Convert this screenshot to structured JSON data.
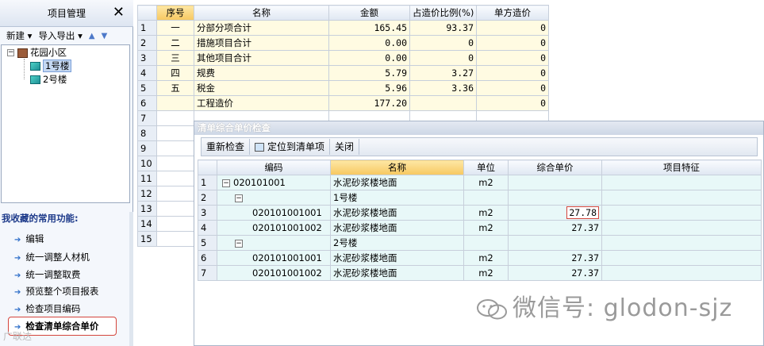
{
  "left_panel": {
    "title": "项目管理",
    "close": "✕",
    "toolbar": {
      "new": "新建 ▾",
      "import_export": "导入导出 ▾",
      "up": "▲",
      "down": "▼"
    },
    "tree": {
      "root": "花园小区",
      "nodes": [
        "1号楼",
        "2号楼"
      ]
    },
    "favorites_title": "我收藏的常用功能:",
    "favorites": [
      "编辑",
      "统一调整人材机",
      "统一调整取费",
      "预览整个项目报表",
      "检查项目编码",
      "检查清单综合单价"
    ]
  },
  "top_grid": {
    "headers": [
      "",
      "序号",
      "名称",
      "金额",
      "占造价比例(%)",
      "单方造价"
    ],
    "rows": [
      [
        "1",
        "一",
        "分部分项合计",
        "165.45",
        "93.37",
        "0"
      ],
      [
        "2",
        "二",
        "措施项目合计",
        "0.00",
        "0",
        "0"
      ],
      [
        "3",
        "三",
        "其他项目合计",
        "0.00",
        "0",
        "0"
      ],
      [
        "4",
        "四",
        "规费",
        "5.79",
        "3.27",
        "0"
      ],
      [
        "5",
        "五",
        "税金",
        "5.96",
        "3.36",
        "0"
      ],
      [
        "6",
        "",
        "工程造价",
        "177.20",
        "",
        "0"
      ],
      [
        "7",
        "",
        "",
        "",
        "",
        ""
      ],
      [
        "8",
        "",
        "",
        "",
        "",
        ""
      ],
      [
        "9",
        "",
        "",
        "",
        "",
        ""
      ],
      [
        "10",
        "",
        "",
        "",
        "",
        ""
      ],
      [
        "11",
        "",
        "",
        "",
        "",
        ""
      ],
      [
        "12",
        "",
        "",
        "",
        "",
        ""
      ],
      [
        "13",
        "",
        "",
        "",
        "",
        ""
      ],
      [
        "14",
        "",
        "",
        "",
        "",
        ""
      ],
      [
        "15",
        "",
        "",
        "",
        "",
        ""
      ]
    ]
  },
  "dialog": {
    "title": "清单综合单价检查",
    "buttons": {
      "recheck": "重新检查",
      "locate": "定位到清单项",
      "close": "关闭"
    },
    "headers": [
      "",
      "编码",
      "名称",
      "单位",
      "综合单价",
      "项目特征"
    ],
    "rows": [
      {
        "n": "1",
        "code": "020101001",
        "name": "水泥砂浆楼地面",
        "unit": "m2",
        "price": ""
      },
      {
        "n": "2",
        "code": "",
        "name": "1号楼",
        "unit": "",
        "price": ""
      },
      {
        "n": "3",
        "code": "020101001001",
        "name": "水泥砂浆楼地面",
        "unit": "m2",
        "price": "27.78"
      },
      {
        "n": "4",
        "code": "020101001002",
        "name": "水泥砂浆楼地面",
        "unit": "m2",
        "price": "27.37"
      },
      {
        "n": "5",
        "code": "",
        "name": "2号楼",
        "unit": "",
        "price": ""
      },
      {
        "n": "6",
        "code": "020101001001",
        "name": "水泥砂浆楼地面",
        "unit": "m2",
        "price": "27.37"
      },
      {
        "n": "7",
        "code": "020101001002",
        "name": "水泥砂浆楼地面",
        "unit": "m2",
        "price": "27.37"
      }
    ]
  },
  "watermark": {
    "text": "微信号: glodon-sjz",
    "corner": "广联达"
  }
}
